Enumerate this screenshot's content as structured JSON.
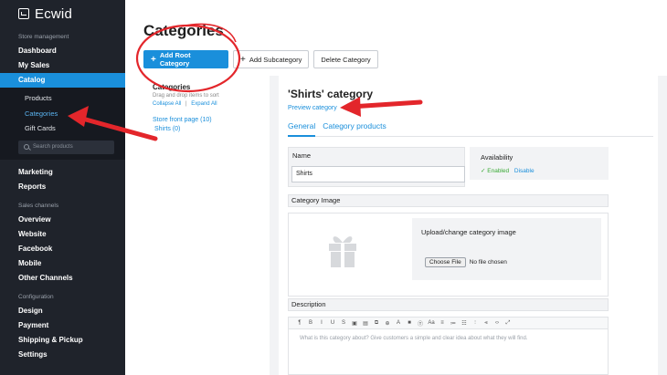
{
  "app": {
    "name": "Ecwid"
  },
  "sidebar": {
    "sections": [
      {
        "title": "Store management"
      },
      {
        "title": "Sales channels"
      },
      {
        "title": "Configuration"
      }
    ],
    "store_items": [
      "Dashboard",
      "My Sales",
      "Catalog"
    ],
    "catalog_subitems": [
      "Products",
      "Categories",
      "Gift Cards"
    ],
    "search_placeholder": "Search products",
    "more_items": [
      "Marketing",
      "Reports"
    ],
    "channel_items": [
      "Overview",
      "Website",
      "Facebook",
      "Mobile",
      "Other Channels"
    ],
    "config_items": [
      "Design",
      "Payment",
      "Shipping & Pickup",
      "Settings"
    ]
  },
  "page": {
    "title": "Categories",
    "buttons": {
      "add_root": "Add Root Category",
      "add_sub": "Add Subcategory",
      "delete": "Delete Category"
    }
  },
  "tree": {
    "title": "Categories",
    "hint": "Drag and drop items to sort",
    "collapse": "Collapse All",
    "separator": "|",
    "expand": "Expand All",
    "root": "Store front page (10)",
    "child": "Shirts (0)"
  },
  "editor_panel": {
    "title": "'Shirts' category",
    "preview": "Preview category",
    "tabs": [
      "General",
      "Category products"
    ],
    "name_label": "Name",
    "name_value": "Shirts",
    "availability_label": "Availability",
    "enabled_label": "✓ Enabled",
    "disable_label": "Disable",
    "image_section": "Category Image",
    "upload_title": "Upload/change category image",
    "choose_file": "Choose File",
    "no_file": "No file chosen",
    "description_section": "Description",
    "description_placeholder": "What is this category about? Give customers a simple and clear idea about what they will find.",
    "toolbar_glyphs": [
      "¶",
      "B",
      "I",
      "U",
      "S",
      "▣",
      "▤",
      "⧉",
      "⊕",
      "A",
      "■",
      "Ⓣ",
      "Aa",
      "≡",
      "≔",
      "☷",
      "⫶",
      "⫷",
      "‹›",
      "⤢"
    ]
  },
  "colors": {
    "sidebar_bg": "#1f232b",
    "accent": "#1a8fdb",
    "annotation_red": "#e3262b",
    "enabled_green": "#3aaa35"
  }
}
